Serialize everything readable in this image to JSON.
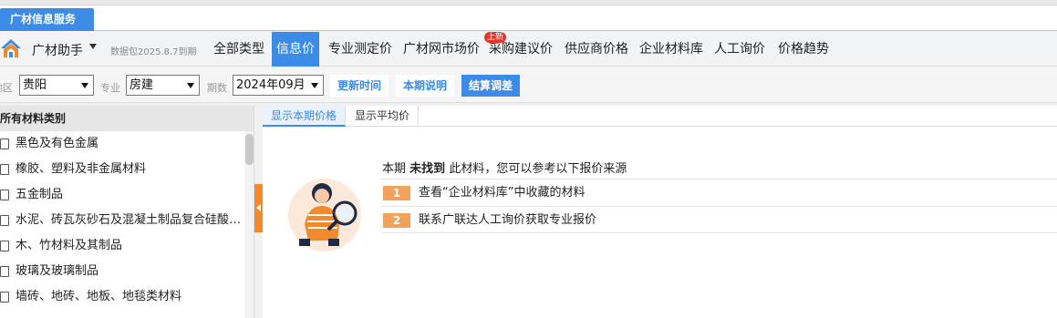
{
  "app_tab": "广材信息服务",
  "nav": {
    "brand": "广材助手",
    "package_info": "数据包2025.8.7到期",
    "items": [
      "全部类型",
      "信息价",
      "专业测定价",
      "广材网市场价",
      "采购建议价",
      "供应商价格",
      "企业材料库",
      "人工询价",
      "价格趋势"
    ],
    "active_item": "信息价",
    "new_badge": "上新"
  },
  "filters": {
    "region_label": "地区",
    "region_value": "贵阳",
    "major_label": "专业",
    "major_value": "房建",
    "period_label": "期数",
    "period_value": "2024年09月",
    "update_time_btn": "更新时间",
    "period_note_btn": "本期说明",
    "settle_btn": "结算调差"
  },
  "categories": {
    "header": "所有材料类别",
    "items": [
      "黑色及有色金属",
      "橡胶、塑料及非金属材料",
      "五金制品",
      "水泥、砖瓦灰砂石及混凝土制品复合硅酸…",
      "木、竹材料及其制品",
      "玻璃及玻璃制品",
      "墙砖、地砖、地板、地毯类材料"
    ]
  },
  "content": {
    "tabs": [
      "显示本期价格",
      "显示平均价"
    ],
    "active_tab": "显示本期价格",
    "msg_prefix": "本期",
    "msg_bold": "未找到",
    "msg_suffix": "此材料，您可以参考以下报价来源",
    "options": [
      {
        "num": "1",
        "text": "查看“企业材料库”中收藏的材料"
      },
      {
        "num": "2",
        "text": "联系广联达人工询价获取专业报价"
      }
    ]
  },
  "colors": {
    "accent": "#3c8be6",
    "orange": "#f08a2c",
    "badge_red": "#e5352c"
  }
}
